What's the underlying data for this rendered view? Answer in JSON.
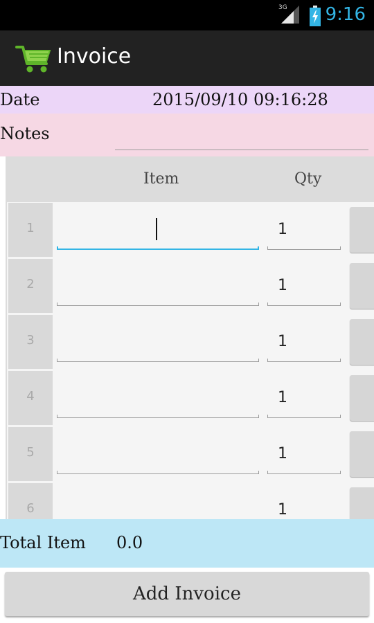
{
  "status_bar": {
    "network_type": "3G",
    "time": "9:16"
  },
  "action_bar": {
    "title": "Invoice",
    "app_icon": "shopping-cart-icon"
  },
  "date": {
    "label": "Date",
    "value": "2015/09/10 09:16:28"
  },
  "notes": {
    "label": "Notes",
    "value": ""
  },
  "table": {
    "headers": {
      "item": "Item",
      "qty": "Qty"
    },
    "rows": [
      {
        "num": "1",
        "item": "",
        "qty": "1"
      },
      {
        "num": "2",
        "item": "",
        "qty": "1"
      },
      {
        "num": "3",
        "item": "",
        "qty": "1"
      },
      {
        "num": "4",
        "item": "",
        "qty": "1"
      },
      {
        "num": "5",
        "item": "",
        "qty": "1"
      },
      {
        "num": "6",
        "item": "",
        "qty": "1"
      }
    ]
  },
  "total": {
    "label": "Total Item",
    "value": "0.0"
  },
  "add_invoice_label": "Add Invoice",
  "colors": {
    "date_row_bg": "#ecd6f8",
    "notes_row_bg": "#f6d8e4",
    "total_row_bg": "#bde7f6",
    "accent": "#33b5e5"
  }
}
